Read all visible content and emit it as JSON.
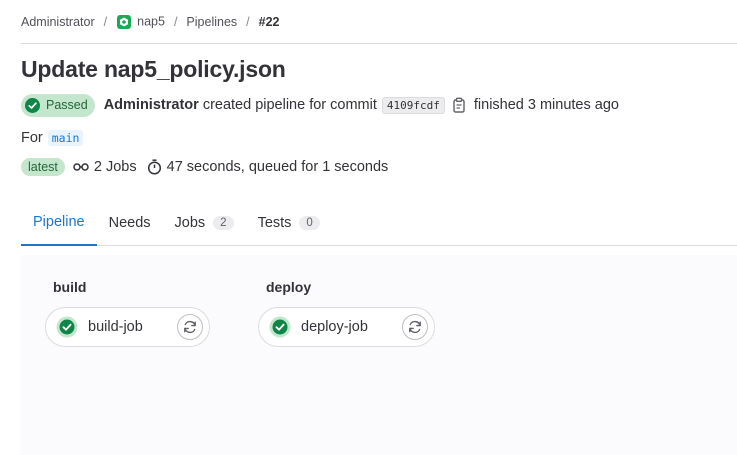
{
  "breadcrumb": {
    "items": [
      "Administrator",
      "nap5",
      "Pipelines"
    ],
    "current": "#22",
    "separator": "/"
  },
  "page": {
    "title": "Update nap5_policy.json"
  },
  "pipeline": {
    "status": "Passed",
    "author": "Administrator",
    "created_text": "created pipeline for commit",
    "commit_sha": "4109fcdf",
    "finished_text": "finished 3 minutes ago",
    "for_label": "For",
    "branch": "main",
    "latest_badge": "latest",
    "jobs_count": "2 Jobs",
    "duration": "47 seconds, queued for 1 seconds"
  },
  "tabs": [
    {
      "label": "Pipeline",
      "count": null
    },
    {
      "label": "Needs",
      "count": null
    },
    {
      "label": "Jobs",
      "count": "2"
    },
    {
      "label": "Tests",
      "count": "0"
    }
  ],
  "stages": [
    {
      "name": "build",
      "job": "build-job"
    },
    {
      "name": "deploy",
      "job": "deploy-job"
    }
  ],
  "colors": {
    "success": "#108548",
    "success_bg": "#c3e6cd",
    "accent": "#1f75cb",
    "graph_bg": "#fbfafd"
  },
  "icons": {
    "status": "check-circle-icon",
    "copy": "clipboard-icon",
    "jobs": "pipeline-icon",
    "duration": "timer-icon",
    "retry": "retry-icon"
  }
}
